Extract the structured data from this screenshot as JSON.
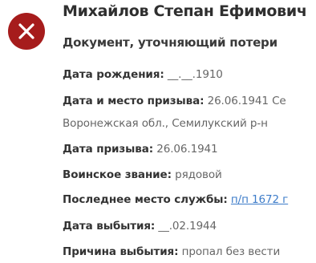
{
  "person": {
    "name": "Михайлов Степан Ефимович",
    "status": "x-icon"
  },
  "document": {
    "type": "Документ, уточняющий потери"
  },
  "fields": {
    "birth_date": {
      "label": "Дата рождения:",
      "value": "__.__.1910"
    },
    "draft_date_place": {
      "label": "Дата и место призыва:",
      "value": "26.06.1941 Се",
      "value_line2": "Воронежская обл., Семилукский р-н"
    },
    "draft_date": {
      "label": "Дата призыва:",
      "value": "26.06.1941"
    },
    "rank": {
      "label": "Воинское звание:",
      "value": "рядовой"
    },
    "last_service": {
      "label": "Последнее место службы:",
      "value": "п/п 1672 г"
    },
    "departure_date": {
      "label": "Дата выбытия:",
      "value": "__.02.1944"
    },
    "departure_reason": {
      "label": "Причина выбытия:",
      "value": "пропал без вести"
    }
  },
  "colors": {
    "status_icon_bg": "#a61c1c",
    "link": "#3d7cc9"
  }
}
